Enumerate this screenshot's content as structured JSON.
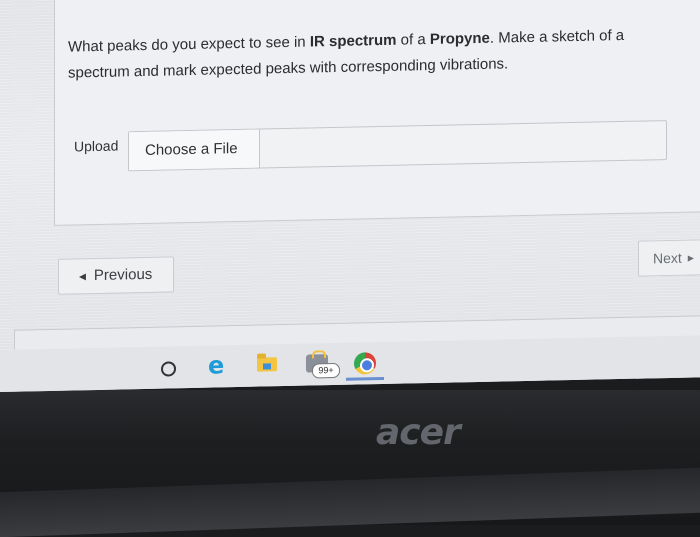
{
  "question": {
    "part1": "What peaks do you expect to see in ",
    "bold1": "IR spectrum",
    "part2": " of a ",
    "bold2": "Propyne",
    "part3": ". Make a sketch of a spectrum and mark expected peaks with corresponding vibrations."
  },
  "upload": {
    "label": "Upload",
    "choose_label": "Choose a File"
  },
  "navigation": {
    "previous_label": "Previous",
    "previous_arrow": "◀",
    "next_label": "Next",
    "next_arrow": "▶"
  },
  "taskbar": {
    "icons": [
      "search-icon",
      "edge-icon",
      "file-explorer-icon",
      "store-icon",
      "chrome-icon"
    ],
    "store_badge": "99+"
  },
  "bezel": {
    "brand": "acer"
  }
}
